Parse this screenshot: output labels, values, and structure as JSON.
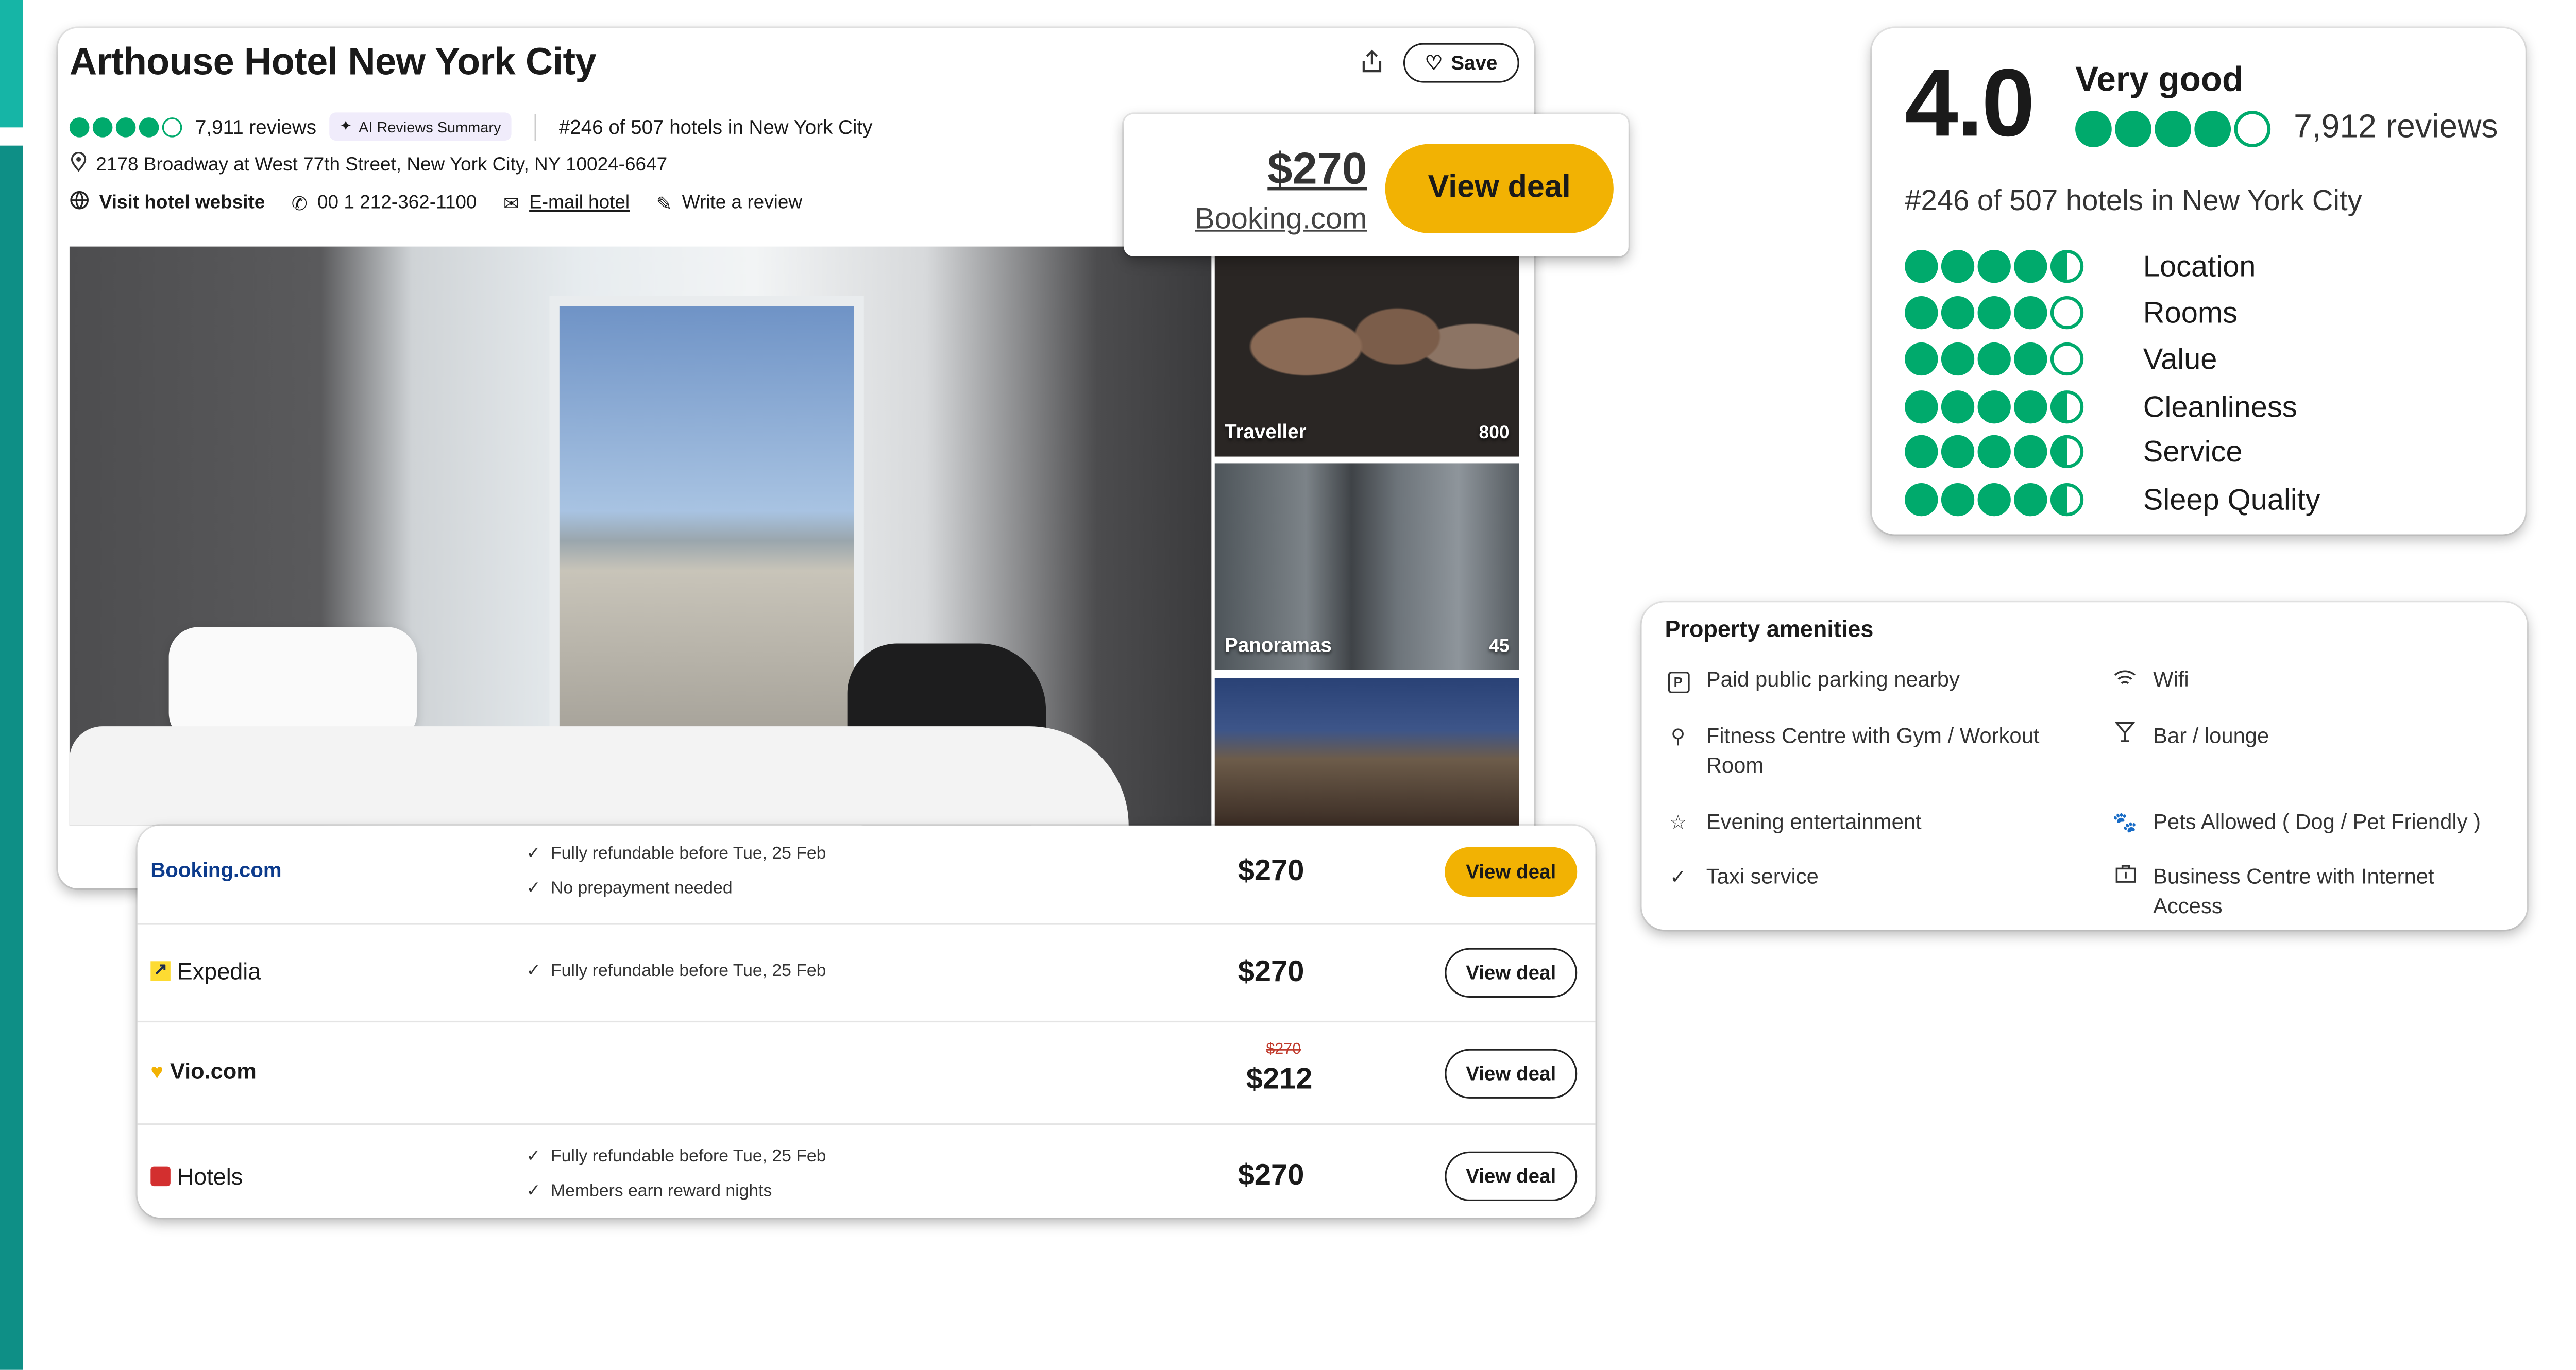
{
  "hotel": {
    "name": "Arthouse Hotel New York City",
    "rating": 4,
    "review_count": "7,911 reviews",
    "ai_chip": "AI Reviews Summary",
    "rank": "#246 of 507 hotels in New York City",
    "address": "2178 Broadway at West 77th Street, New York City, NY 10024-6647",
    "website": "Visit hotel website",
    "phone": "00 1 212-362-1100",
    "email": "E-mail hotel",
    "review": "Write a review",
    "save": "Save"
  },
  "photos": {
    "thumbs": [
      {
        "label": "Traveller",
        "count": "800"
      },
      {
        "label": "Panoramas",
        "count": "45"
      },
      {
        "label": "",
        "count": ""
      }
    ]
  },
  "featured_offer": {
    "price": "$270",
    "site": "Booking.com",
    "button": "View deal"
  },
  "deals": [
    {
      "provider": "Booking.com",
      "features": [
        "Fully refundable before Tue, 25 Feb",
        "No prepayment needed"
      ],
      "price": "$270",
      "old_price": "",
      "button": "View deal"
    },
    {
      "provider": "Expedia",
      "features": [
        "Fully refundable before Tue, 25 Feb"
      ],
      "price": "$270",
      "old_price": "",
      "button": "View deal"
    },
    {
      "provider": "Vio.com",
      "features": [],
      "price": "$212",
      "old_price": "$270",
      "button": "View deal"
    },
    {
      "provider": "Hotels",
      "features": [
        "Fully refundable before Tue, 25 Feb",
        "Members earn reward nights"
      ],
      "price": "$270",
      "old_price": "",
      "button": "View deal"
    }
  ],
  "rating_summary": {
    "score": "4.0",
    "label": "Very good",
    "reviews": "7,912 reviews",
    "rank": "#246 of 507 hotels in New York City",
    "subratings": [
      {
        "name": "Location",
        "value": 4.5
      },
      {
        "name": "Rooms",
        "value": 4
      },
      {
        "name": "Value",
        "value": 4
      },
      {
        "name": "Cleanliness",
        "value": 4.5
      },
      {
        "name": "Service",
        "value": 4.5
      },
      {
        "name": "Sleep Quality",
        "value": 4.5
      }
    ]
  },
  "amenities": {
    "title": "Property amenities",
    "items": [
      {
        "label": "Paid public parking nearby",
        "icon": "parking-icon"
      },
      {
        "label": "Wifi",
        "icon": "wifi-icon"
      },
      {
        "label": "Fitness Centre with Gym / Workout Room",
        "icon": "fitness-icon"
      },
      {
        "label": "Bar / lounge",
        "icon": "cocktail-icon"
      },
      {
        "label": "Evening entertainment",
        "icon": "star-icon"
      },
      {
        "label": "Pets Allowed ( Dog / Pet Friendly )",
        "icon": "paw-icon"
      },
      {
        "label": "Taxi service",
        "icon": "check-icon"
      },
      {
        "label": "Business Centre with Internet Access",
        "icon": "briefcase-icon"
      }
    ]
  },
  "colors": {
    "brand_green": "#00aa6c",
    "deal_yellow": "#f2b203",
    "side_teal": "#0e8f86"
  }
}
